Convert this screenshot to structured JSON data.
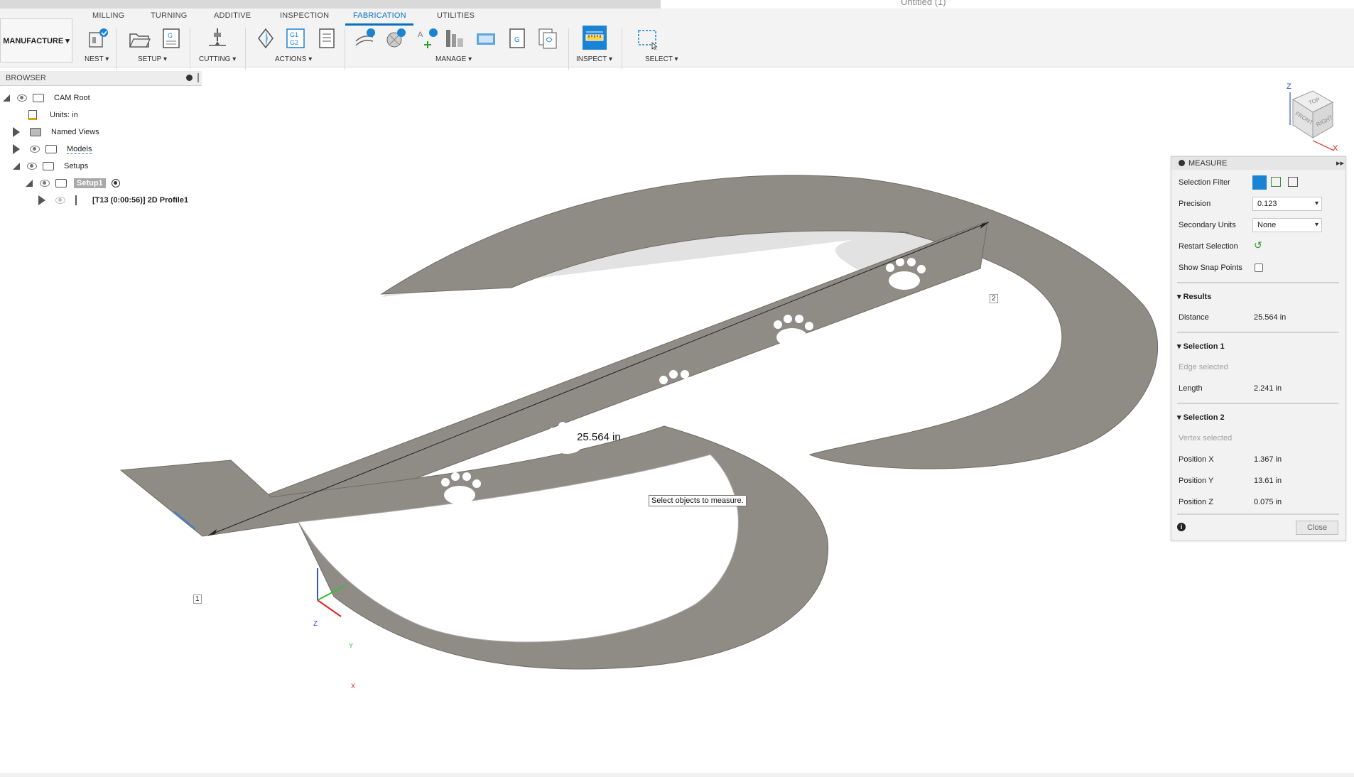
{
  "window": {
    "document_title": "Untitled (1)"
  },
  "toolbar": {
    "workspace": "MANUFACTURE ▾",
    "tabs": [
      {
        "label": "MILLING"
      },
      {
        "label": "TURNING"
      },
      {
        "label": "ADDITIVE"
      },
      {
        "label": "INSPECTION"
      },
      {
        "label": "FABRICATION"
      },
      {
        "label": "UTILITIES"
      }
    ],
    "groups": [
      {
        "label": "NEST ▾"
      },
      {
        "label": "SETUP ▾"
      },
      {
        "label": "CUTTING ▾"
      },
      {
        "label": "ACTIONS ▾"
      },
      {
        "label": "MANAGE ▾"
      },
      {
        "label": "INSPECT ▾"
      },
      {
        "label": "SELECT ▾"
      }
    ],
    "accent_color": "#0a6fbf"
  },
  "browser": {
    "title": "BROWSER",
    "items": [
      {
        "label": "CAM Root"
      },
      {
        "label": "Units: in"
      },
      {
        "label": "Named Views"
      },
      {
        "label": "Models"
      },
      {
        "label": "Setups"
      },
      {
        "label": "Setup1"
      },
      {
        "label": "[T13 (0:00:56)] 2D Profile1"
      }
    ]
  },
  "viewport": {
    "dimension_text": "25.564 in",
    "tooltip": "Select objects to measure.",
    "point1": "1",
    "point2": "2",
    "viewcube": {
      "top": "TOP",
      "front": "FRONT",
      "right": "RIGHT",
      "z": "Z",
      "x": "X"
    },
    "triad": {
      "z": "Z",
      "y": "Y",
      "x": "X"
    }
  },
  "measure": {
    "title": "MEASURE",
    "selection_filter_label": "Selection Filter",
    "precision_label": "Precision",
    "precision_value": "0.123",
    "secondary_units_label": "Secondary Units",
    "secondary_units_value": "None",
    "restart_label": "Restart Selection",
    "snap_label": "Show Snap Points",
    "results_title": "Results",
    "distance_label": "Distance",
    "distance_value": "25.564 in",
    "sel1_title": "Selection 1",
    "sel1_hint": "Edge selected",
    "length_label": "Length",
    "length_value": "2.241 in",
    "sel2_title": "Selection 2",
    "sel2_hint": "Vertex selected",
    "posx_label": "Position X",
    "posx_value": "1.367 in",
    "posy_label": "Position Y",
    "posy_value": "13.61 in",
    "posz_label": "Position Z",
    "posz_value": "0.075 in",
    "close_label": "Close"
  }
}
